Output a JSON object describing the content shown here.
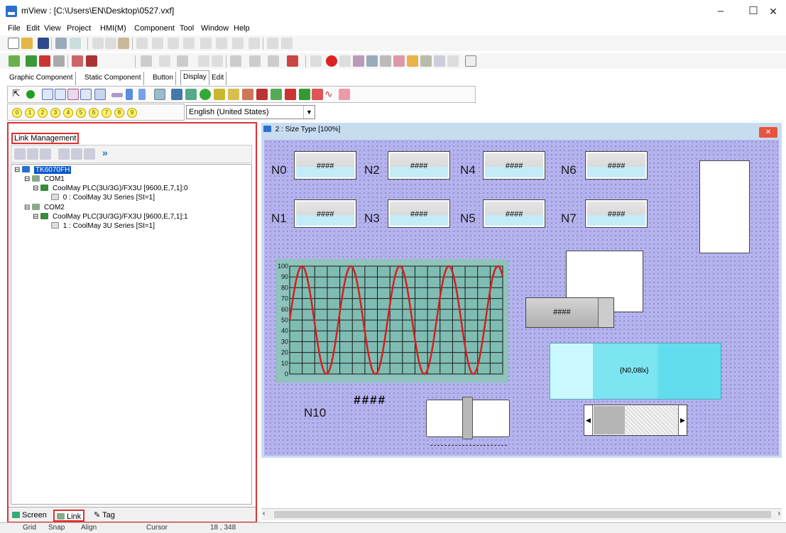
{
  "window": {
    "title": "mView : [C:\\Users\\EN\\Desktop\\0527.vxf]"
  },
  "menu": [
    "File",
    "Edit",
    "View",
    "Project",
    "HMI(M)",
    "Component",
    "Tool",
    "Window",
    "Help"
  ],
  "component_tabs": [
    "Graphic Component",
    "Static Component",
    "Button",
    "Display",
    "Edit"
  ],
  "number_buttons": [
    "0",
    "1",
    "2",
    "3",
    "4",
    "5",
    "6",
    "7",
    "8",
    "9"
  ],
  "language": "English (United States)",
  "left_panel": {
    "title": "Link Management",
    "tree": {
      "root": "TK6070FH",
      "com1": "COM1",
      "com1_plc": "CoolMay PLC(3U/3G)/FX3U [9600,E,7,1]:0",
      "com1_dev": "0 : CoolMay 3U Series [St=1]",
      "com2": "COM2",
      "com2_plc": "CoolMay PLC(3U/3G)/FX3U [9600,E,7,1]:1",
      "com2_dev": "1 : CoolMay 3U Series [St=1]"
    },
    "tabs": [
      "Screen",
      "Link",
      "Tag"
    ]
  },
  "screen": {
    "title": "2 : Size Type [100%]",
    "numeric_labels": [
      "N0",
      "N2",
      "N4",
      "N6",
      "N1",
      "N3",
      "N5",
      "N7"
    ],
    "numeric_value": "####",
    "n10_label": "N10",
    "n10_value": "####",
    "small_display_value": "####",
    "text_display": "{N0,08lx}"
  },
  "chart_data": {
    "type": "line",
    "y_ticks": [
      "100",
      "90",
      "80",
      "70",
      "60",
      "50",
      "40",
      "30",
      "20",
      "10",
      "0"
    ],
    "ylim": [
      0,
      100
    ],
    "series": [
      {
        "color": "#d42020",
        "cycles": 4.35,
        "phase_start": 50
      }
    ]
  },
  "status": {
    "grid": "Grid",
    "snap": "Snap",
    "align": "Align",
    "cursor": "Cursor",
    "coords": "18 , 348"
  },
  "colors": {
    "highlight": "#e03030",
    "canvas_bg": "#b5b3ee",
    "chart_bg": "#8fc3bb",
    "wave": "#d42020"
  }
}
